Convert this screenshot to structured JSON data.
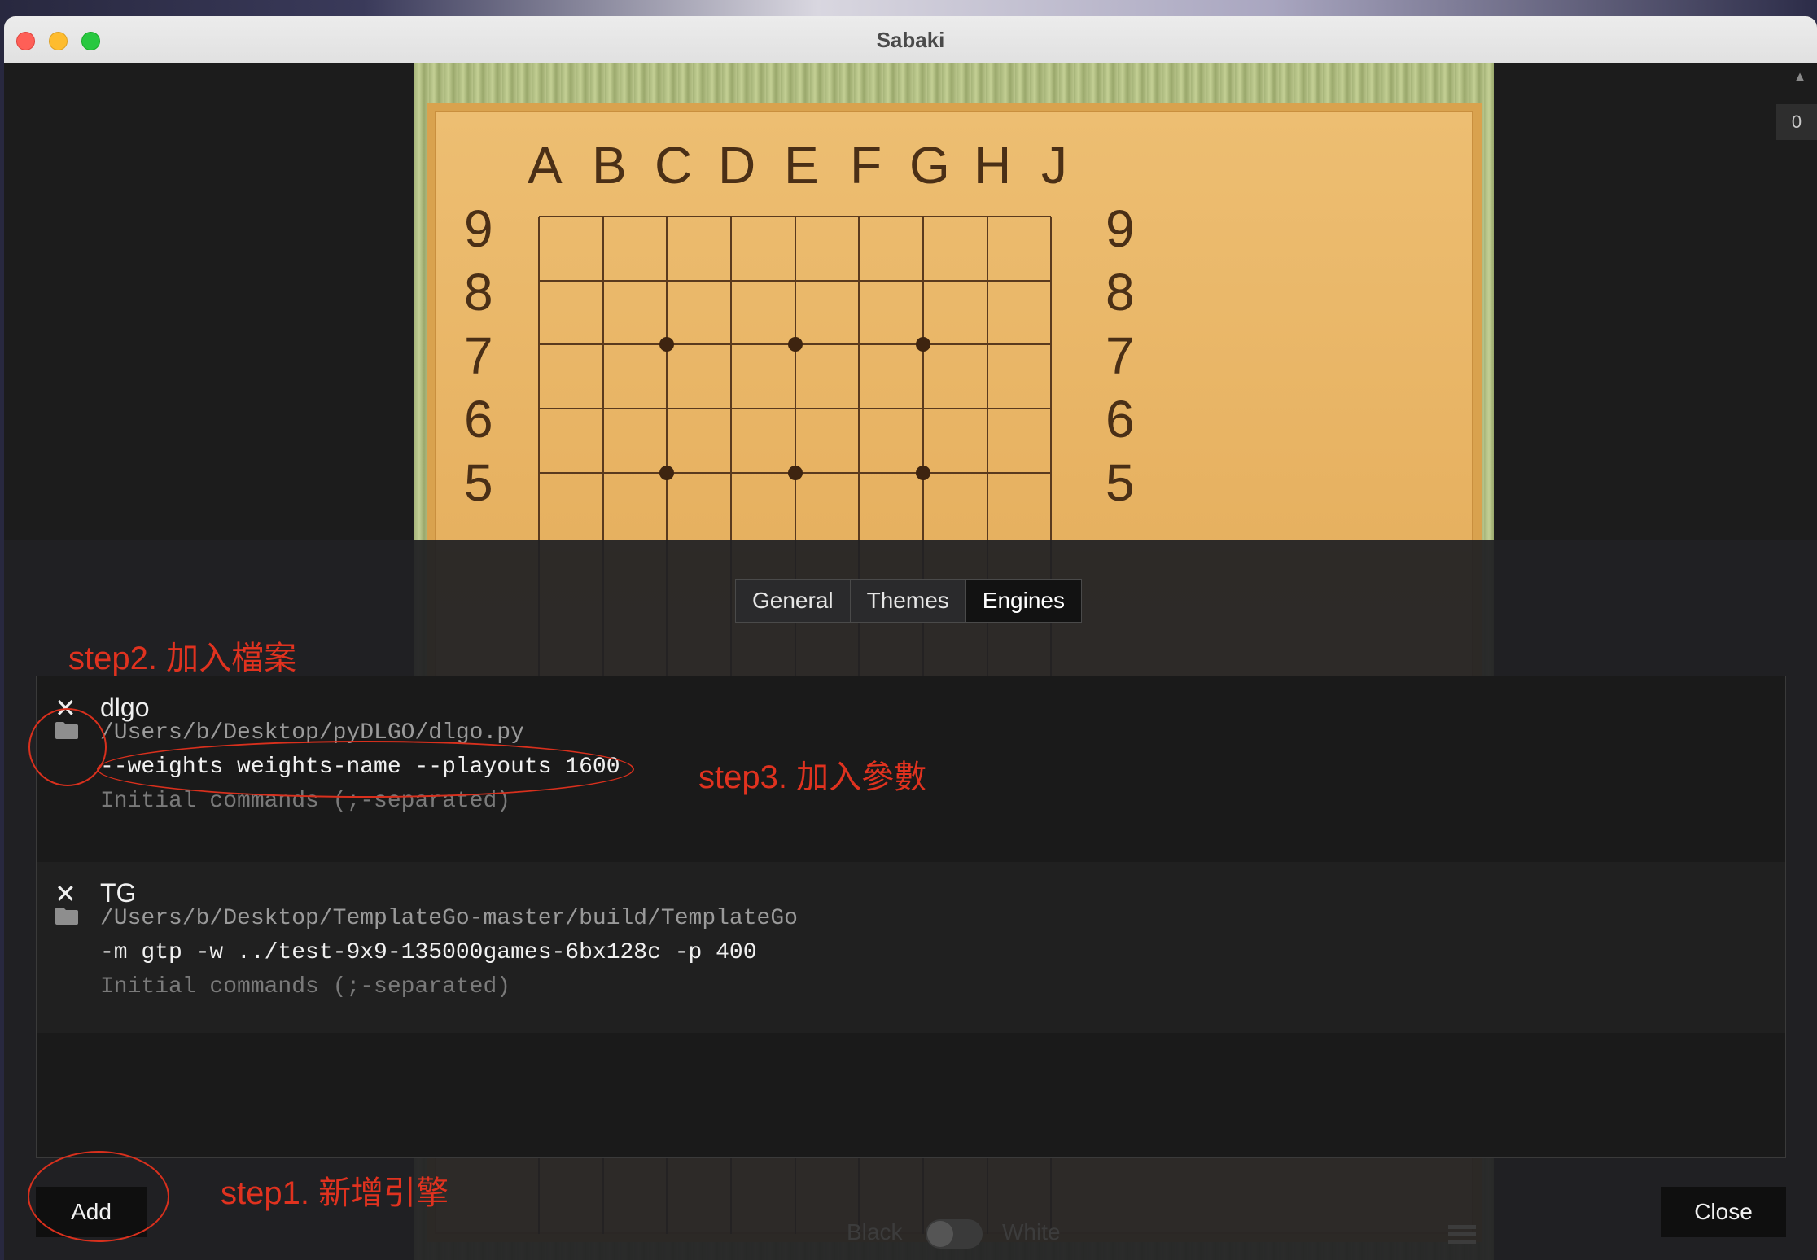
{
  "window": {
    "title": "Sabaki"
  },
  "board": {
    "columns": [
      "A",
      "B",
      "C",
      "D",
      "E",
      "F",
      "G",
      "H",
      "J"
    ],
    "rows": [
      "9",
      "8",
      "7",
      "6",
      "5"
    ]
  },
  "sidebar": {
    "counter": "0"
  },
  "preferences": {
    "tabs": [
      {
        "label": "General"
      },
      {
        "label": "Themes"
      },
      {
        "label": "Engines"
      }
    ],
    "active_tab": "Engines",
    "engines": [
      {
        "name": "dlgo",
        "path": "/Users/b/Desktop/pyDLGO/dlgo.py",
        "args": "--weights weights-name --playouts 1600",
        "commands_placeholder": "Initial commands (;-separated)"
      },
      {
        "name": "TG",
        "path": "/Users/b/Desktop/TemplateGo-master/build/TemplateGo",
        "args": "-m gtp -w ../test-9x9-135000games-6bx128c -p 400",
        "commands_placeholder": "Initial commands (;-separated)"
      }
    ],
    "add_label": "Add",
    "close_label": "Close"
  },
  "footer": {
    "black_label": "Black",
    "white_label": "White"
  },
  "annotations": {
    "step1": "step1. 新增引擎",
    "step2": "step2. 加入檔案",
    "step3": "step3. 加入參數"
  },
  "colors": {
    "annotation": "#e0321f",
    "board": "#e9b764",
    "grid": "#5a3a1e"
  }
}
